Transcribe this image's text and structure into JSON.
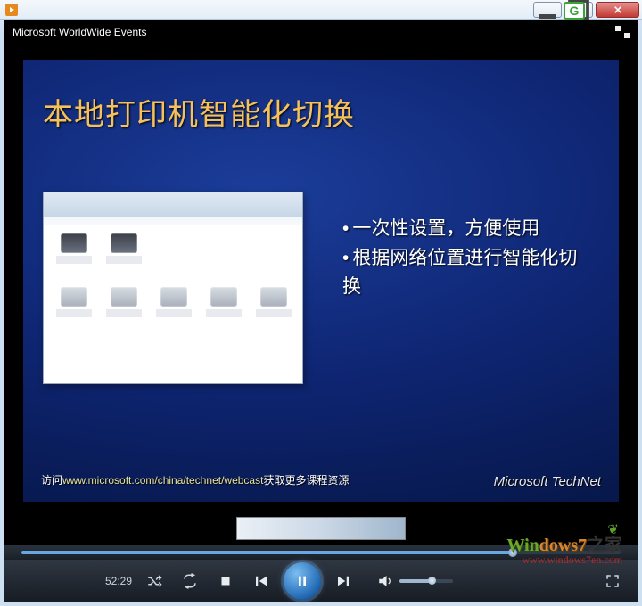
{
  "window": {
    "title_attr": "Windows Media Player"
  },
  "header": {
    "title": "Microsoft WorldWide Events"
  },
  "slide": {
    "title": "本地打印机智能化切换",
    "bullets": [
      "一次性设置，方便使用",
      "根据网络位置进行智能化切换"
    ],
    "footer_prefix": "访问",
    "footer_url": "www.microsoft.com/china/technet/webcast",
    "footer_suffix": "获取更多课程资源",
    "brand_a": "Microsoft",
    "brand_b": "TechNet"
  },
  "playback": {
    "time": "52:29"
  },
  "watermark": {
    "line1_a": "Win",
    "line1_b": "dows",
    "line1_c": "7",
    "line1_d": "之家",
    "line2": "www.windows7en.com"
  }
}
